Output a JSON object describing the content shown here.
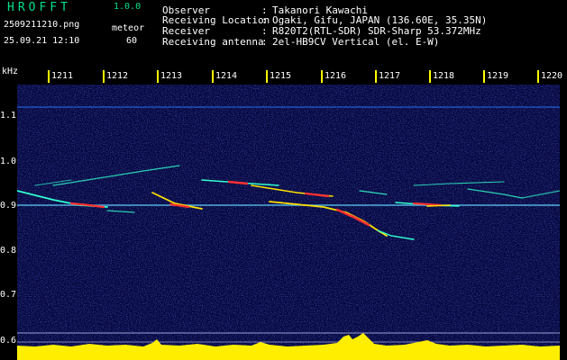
{
  "app": {
    "title": "HROFFT",
    "version": "1.0.0",
    "file_name": "2509211210.png",
    "date_time": "25.09.21 12:10",
    "mode_label": "meteor",
    "count": "60"
  },
  "station": [
    {
      "label": "Observer",
      "value": "Takanori Kawachi"
    },
    {
      "label": "Receiving Location",
      "value": "Ogaki, Gifu, JAPAN (136.60E, 35.35N)"
    },
    {
      "label": "Receiver",
      "value": "R820T2(RTL-SDR) SDR-Sharp 53.372MHz"
    },
    {
      "label": "Receiving antenna",
      "value": "2el-HB9CV Vertical (el. E-W)"
    }
  ],
  "axis": {
    "unit_label": "kHz",
    "time_ticks": [
      "1211",
      "1212",
      "1213",
      "1214",
      "1215",
      "1216",
      "1217",
      "1218",
      "1219",
      "1220"
    ],
    "freq_ticks": [
      "1.1",
      "1.0",
      "0.9",
      "0.8",
      "0.7",
      "0.6"
    ]
  },
  "colors": {
    "background": "#06073f",
    "tick_mark": "#ffff00",
    "header_accent": "#00e08a",
    "signal_hot": "#ff3030",
    "signal_warm": "#ffe000",
    "signal_cool": "#30ffd0",
    "bottom_level": "#ffee00",
    "bottom_base": "#00d8ff"
  }
}
